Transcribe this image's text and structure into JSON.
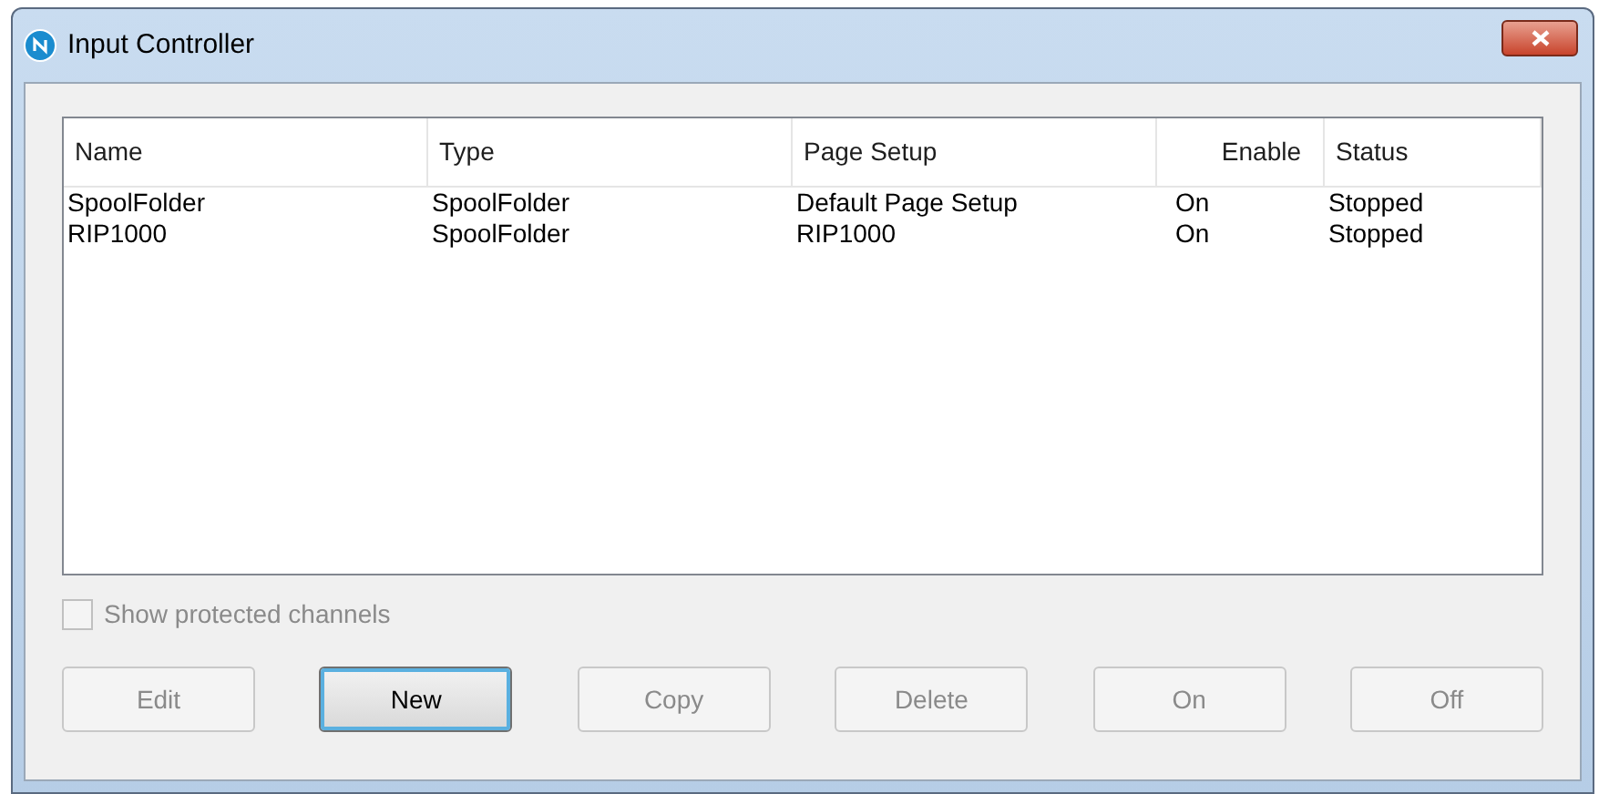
{
  "window": {
    "title": "Input Controller"
  },
  "table": {
    "columns": [
      "Name",
      "Type",
      "Page Setup",
      "Enable",
      "Status"
    ],
    "rows": [
      {
        "cells": [
          "SpoolFolder",
          "SpoolFolder",
          "Default Page Setup",
          "On",
          "Stopped"
        ]
      },
      {
        "cells": [
          "RIP1000",
          "SpoolFolder",
          "RIP1000",
          "On",
          "Stopped"
        ]
      }
    ]
  },
  "show_protected": {
    "label": "Show protected channels",
    "checked": false,
    "disabled": true
  },
  "buttons": [
    {
      "label": "Edit",
      "disabled": true,
      "focused": false
    },
    {
      "label": "New",
      "disabled": false,
      "focused": true
    },
    {
      "label": "Copy",
      "disabled": true,
      "focused": false
    },
    {
      "label": "Delete",
      "disabled": true,
      "focused": false
    },
    {
      "label": "On",
      "disabled": true,
      "focused": false
    },
    {
      "label": "Off",
      "disabled": true,
      "focused": false
    }
  ]
}
